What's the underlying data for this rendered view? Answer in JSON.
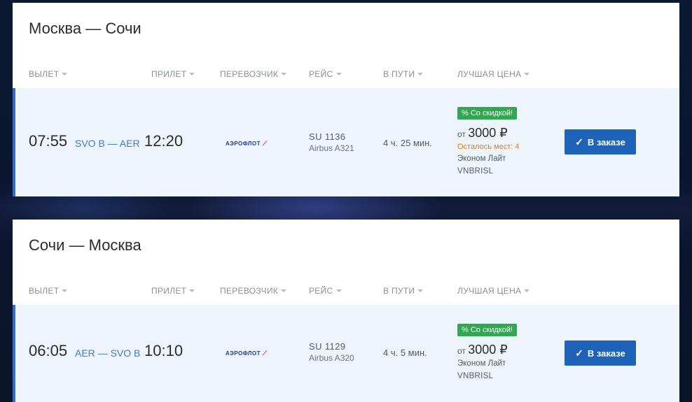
{
  "columns": {
    "departure": "ВЫЛЕТ",
    "arrival": "ПРИЛЕТ",
    "carrier": "ПЕРЕВОЗЧИК",
    "flight": "РЕЙС",
    "duration": "В ПУТИ",
    "best_price": "ЛУЧШАЯ ЦЕНА"
  },
  "segments": [
    {
      "title": "Москва — Сочи",
      "departure_time": "07:55",
      "route": "SVO B — AER",
      "arrival_time": "12:20",
      "carrier_logo": "АЭРОФЛОТ",
      "flight_number": "SU 1136",
      "aircraft": "Airbus A321",
      "duration": "4 ч. 25 мин.",
      "badge": "% Со скидкой!",
      "price_prefix": "от",
      "price": "3000 ₽",
      "seats_left": "Осталось мест: 4",
      "fare_name": "Эконом Лайт",
      "fare_code": "VNBRISL",
      "button_label": "В заказе"
    },
    {
      "title": "Сочи — Москва",
      "departure_time": "06:05",
      "route": "AER — SVO B",
      "arrival_time": "10:10",
      "carrier_logo": "АЭРОФЛОТ",
      "flight_number": "SU 1129",
      "aircraft": "Airbus A320",
      "duration": "4 ч. 5 мин.",
      "badge": "% Со скидкой!",
      "price_prefix": "от",
      "price": "3000 ₽",
      "fare_name": "Эконом Лайт",
      "fare_code": "VNBRISL",
      "button_label": "В заказе"
    }
  ],
  "colors": {
    "accent": "#1f63b8",
    "row_bg": "#eef4fb",
    "discount_badge": "#2fa84f",
    "seats_warning": "#e07c24",
    "route_text": "#3d7bd0"
  },
  "icons": {
    "sort": "caret-down-icon",
    "button": "check-icon"
  }
}
